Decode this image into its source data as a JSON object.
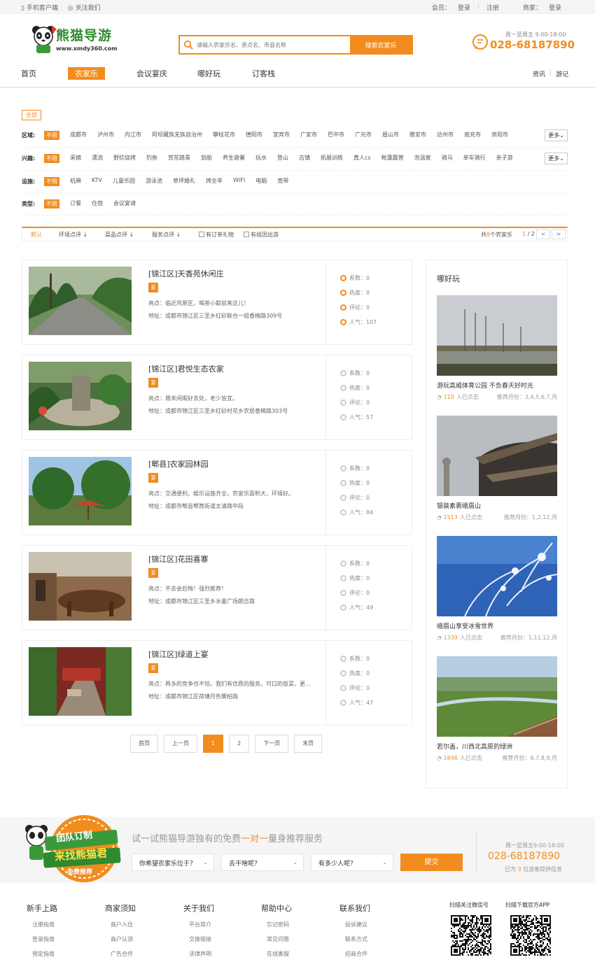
{
  "topbar": {
    "mobile": "手机客户端",
    "follow": "关注我们",
    "member_label": "会员：",
    "member_login": "登录",
    "member_register": "注册",
    "merchant_label": "商家：",
    "merchant_login": "登录"
  },
  "header": {
    "logo_text": "熊猫导游",
    "logo_url": "www.xmdy360.com",
    "search_placeholder": "请输入农家乐名、景点名、市县名称",
    "search_button": "搜索农家乐",
    "hotline_time": "周一至周五 9:00-18:00",
    "hotline_phone": "028-68187890"
  },
  "nav": {
    "items": [
      "首页",
      "农家乐",
      "会议宴庆",
      "哪好玩",
      "订客栈"
    ],
    "active": "农家乐",
    "right": [
      "资讯",
      "游记"
    ]
  },
  "filters": {
    "all_label": "全部",
    "rows": [
      {
        "label": "区域:",
        "options": [
          "不限",
          "成都市",
          "泸州市",
          "内江市",
          "阿坝藏族羌族自治州",
          "攀枝花市",
          "德阳市",
          "宜宾市",
          "广安市",
          "巴中市",
          "广元市",
          "眉山市",
          "雅安市",
          "达州市",
          "南充市",
          "资阳市"
        ],
        "more": "更多"
      },
      {
        "label": "兴趣:",
        "options": [
          "不限",
          "采摘",
          "漂流",
          "野炊烧烤",
          "钓鱼",
          "赏花踏青",
          "划船",
          "养生避暑",
          "玩水",
          "登山",
          "古镇",
          "拓展训练",
          "真人cs",
          "帐篷露营",
          "泡温泉",
          "骑马",
          "单车骑行",
          "亲子游"
        ],
        "more": "更多"
      },
      {
        "label": "设施:",
        "options": [
          "不限",
          "机麻",
          "KTV",
          "儿童乐园",
          "游泳池",
          "草坪婚礼",
          "烤全羊",
          "WIFI",
          "电脑",
          "宽带"
        ]
      },
      {
        "label": "类型:",
        "options": [
          "不限",
          "订餐",
          "住宿",
          "会议宴请"
        ]
      }
    ]
  },
  "sortbar": {
    "default": "默认",
    "sort_env": "环境点评",
    "sort_dish": "菜品点评",
    "sort_service": "服务点评",
    "check_gift": "有订单礼物",
    "check_group": "有组团出游",
    "count_prefix": "共",
    "count_num": "8",
    "count_suffix": "个农家乐",
    "page_cur": "1",
    "page_total": "/ 2",
    "prev": "<",
    "next": ">"
  },
  "listings": [
    {
      "name": "[锦江区]天香苑休闲庄",
      "tag": "宴",
      "highlight": "亮点：临近风景区，喝茶小歇就来这儿！",
      "address": "地址：成都市锦江区三圣乡红砂联合一组香楠路309号",
      "coef": "系数：0",
      "heat": "热度：0",
      "reviews": "评论：0",
      "popularity": "人气：107"
    },
    {
      "name": "[锦江区]君悦生态农家",
      "tag": "宴",
      "highlight": "亮点：周末闲暇好去处，老少皆宜。",
      "address": "地址：成都市锦江区三圣乡红砂村花乡农居香楠路303号",
      "coef": "系数：0",
      "heat": "热度：0",
      "reviews": "评论：0",
      "popularity": "人气：57"
    },
    {
      "name": "[郫县]农家园林园",
      "tag": "宴",
      "highlight": "亮点：交通便利，娱乐设施齐全，农家乐面积大，环境好。",
      "address": "地址：成都市郫县郫筒街道太清路中段",
      "coef": "系数：0",
      "heat": "热度：0",
      "reviews": "评论：0",
      "popularity": "人气：84"
    },
    {
      "name": "[锦江区]花田喜寨",
      "tag": "宴",
      "highlight": "亮点：不去会后悔！强烈推荐！",
      "address": "地址：成都市锦江区三圣乡水墨广场朗吉路",
      "coef": "系数：0",
      "heat": "热度：0",
      "reviews": "评论：0",
      "popularity": "人气：49"
    },
    {
      "name": "[锦江区]绿道上宴",
      "tag": "宴",
      "highlight": "亮点：再多的竞争也不怕，我们有优质的服务，可口的饭菜，更...",
      "address": "地址：成都市锦江区荷塘月色簧柏路",
      "coef": "系数：0",
      "heat": "热度：0",
      "reviews": "评论：0",
      "popularity": "人气：47"
    }
  ],
  "pager": [
    "首页",
    "上一页",
    "1",
    "2",
    "下一页",
    "末页"
  ],
  "sidebar": {
    "title": "哪好玩",
    "spots": [
      {
        "name": "游玩高威体育公园 不负春天好时光",
        "clicks": "110",
        "clicks_suffix": "人已点击",
        "month": "推荐月份：3,4,5,6,7,月"
      },
      {
        "name": "银装素裹峨眉山",
        "clicks": "1513",
        "clicks_suffix": "人已点击",
        "month": "推荐月份：1,2,12,月"
      },
      {
        "name": "峨眉山享受冰雪世界",
        "clicks": "1339",
        "clicks_suffix": "人已点击",
        "month": "推荐月份：1,11,12,月"
      },
      {
        "name": "若尔盖，川西北高原的绿洲",
        "clicks": "1846",
        "clicks_suffix": "人已点击",
        "month": "推荐月份：6,7,8,9,月"
      }
    ]
  },
  "banner": {
    "badge_line1": "团队订制",
    "badge_line2": "来找熊猫君",
    "badge_line3": "免费推荐",
    "slogan_a": "试一试熊猫导游独有的免费",
    "slogan_b": "一对一",
    "slogan_c": "量身推荐服务",
    "select1": "你希望农家乐位于？",
    "select2": "去干啥呢？",
    "select3": "有多少人呢？",
    "submit": "提交",
    "time": "周一至周五9:00-18:00",
    "phone": "028-68187890",
    "note_a": "已为",
    "note_b": "3",
    "note_c": "位游客提供信息"
  },
  "footer": {
    "cols": [
      {
        "title": "新手上路",
        "links": [
          "注册指南",
          "登录指南",
          "预定指南"
        ]
      },
      {
        "title": "商家须知",
        "links": [
          "商户入住",
          "商户认领",
          "广告合作"
        ]
      },
      {
        "title": "关于我们",
        "links": [
          "平台简介",
          "交换链接",
          "法律声明"
        ]
      },
      {
        "title": "帮助中心",
        "links": [
          "忘记密码",
          "常见问题",
          "在线客服"
        ]
      },
      {
        "title": "联系我们",
        "links": [
          "投诉建议",
          "联系方式",
          "招商合作"
        ]
      }
    ],
    "qr_wechat": "扫描关注微信号",
    "qr_app": "扫描下载官方APP"
  },
  "colors": {
    "accent": "#f28c1e",
    "brand_green": "#2f8a2f"
  }
}
